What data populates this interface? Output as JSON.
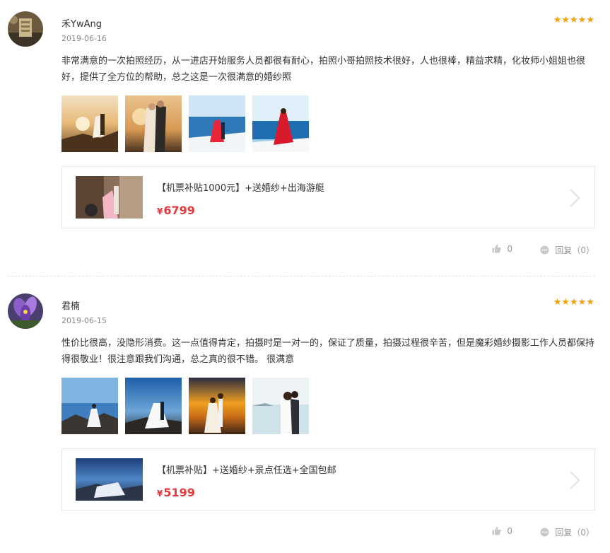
{
  "reviews": [
    {
      "username": "禾YwAng",
      "date": "2019-06-16",
      "stars": "★★★★★",
      "content": "非常满意的一次拍照经历，从一进店开始服务人员都很有耐心，拍照小哥拍照技术很好，人也很棒，精益求精，化妆师小姐姐也很好，提供了全方位的帮助，总之这是一次很满意的婚纱照",
      "product": {
        "title": "【机票补贴1000元】+送婚纱+出海游艇",
        "currency": "¥",
        "price": "6799"
      },
      "likes": "0",
      "reply_label": "回复（0）"
    },
    {
      "username": "君楠",
      "date": "2019-06-15",
      "stars": "★★★★★",
      "content": "性价比很高，没隐形消费。这一点值得肯定，拍摄时是一对一的，保证了质量，拍摄过程很辛苦，但是魔彩婚纱摄影工作人员都保持得很敬业！很注意跟我们沟通，总之真的很不错。 很满意",
      "product": {
        "title": "【机票补贴】+送婚纱+景点任选+全国包邮",
        "currency": "¥",
        "price": "5199"
      },
      "likes": "0",
      "reply_label": "回复（0）"
    }
  ],
  "colors": {
    "star": "#f5a00f",
    "price": "#e4393c",
    "muted": "#999999"
  }
}
